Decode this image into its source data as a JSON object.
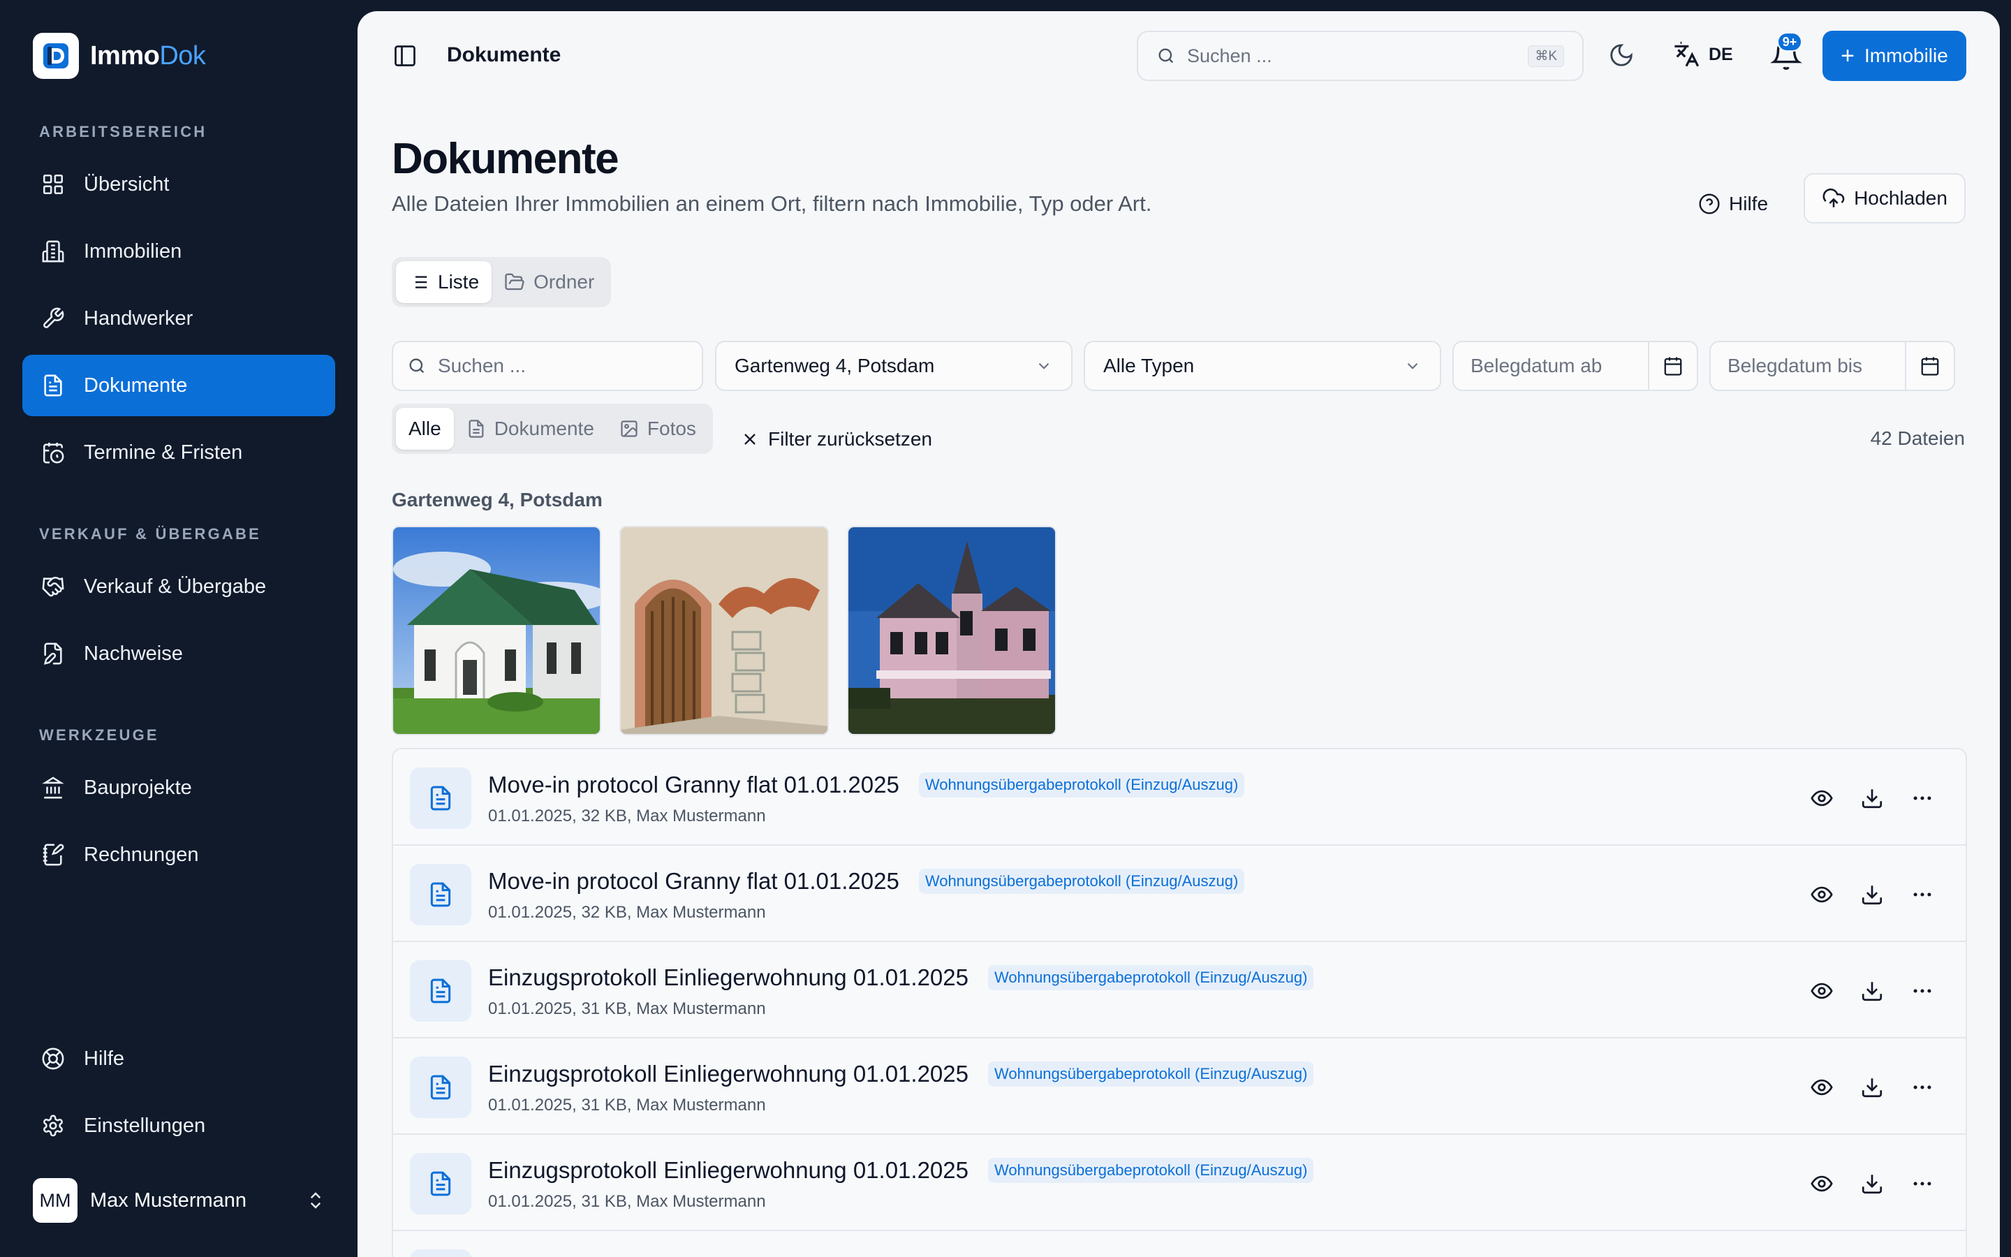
{
  "app": {
    "name_a": "Immo",
    "name_b": "Dok"
  },
  "sidebar": {
    "sections": [
      {
        "label": "ARBEITSBEREICH"
      },
      {
        "label": "VERKAUF & ÜBERGABE"
      },
      {
        "label": "WERKZEUGE"
      }
    ],
    "items": [
      {
        "label": "Übersicht",
        "icon": "dashboard-icon"
      },
      {
        "label": "Immobilien",
        "icon": "building-icon"
      },
      {
        "label": "Handwerker",
        "icon": "wrench-icon"
      },
      {
        "label": "Dokumente",
        "icon": "document-icon",
        "active": true
      },
      {
        "label": "Termine & Fristen",
        "icon": "calendar-clock-icon"
      },
      {
        "label": "Verkauf & Übergabe",
        "icon": "handshake-icon"
      },
      {
        "label": "Nachweise",
        "icon": "file-edit-icon"
      },
      {
        "label": "Bauprojekte",
        "icon": "bank-icon"
      },
      {
        "label": "Rechnungen",
        "icon": "receipt-icon"
      },
      {
        "label": "Hilfe",
        "icon": "lifebuoy-icon"
      },
      {
        "label": "Einstellungen",
        "icon": "gear-icon"
      }
    ],
    "user": {
      "initials": "MM",
      "name": "Max Mustermann"
    }
  },
  "topbar": {
    "breadcrumb": "Dokumente",
    "search_placeholder": "Suchen ...",
    "shortcut": "⌘K",
    "language": "DE",
    "notifications": "9+",
    "add_label": "Immobilie"
  },
  "page": {
    "title": "Dokumente",
    "subtitle": "Alle Dateien Ihrer Immobilien an einem Ort, filtern nach Immobilie, Typ oder Art.",
    "help_label": "Hilfe",
    "upload_label": "Hochladen",
    "view_tabs": [
      {
        "label": "Liste",
        "active": true
      },
      {
        "label": "Ordner"
      }
    ],
    "filters": {
      "search_placeholder": "Suchen ...",
      "property": "Gartenweg 4, Potsdam",
      "type": "Alle Typen",
      "date_from_placeholder": "Belegdatum ab",
      "date_to_placeholder": "Belegdatum bis"
    },
    "kind_tabs": [
      {
        "label": "Alle",
        "active": true
      },
      {
        "label": "Dokumente"
      },
      {
        "label": "Fotos"
      }
    ],
    "reset_label": "Filter zurücksetzen",
    "count": "42 Dateien",
    "group_title": "Gartenweg 4, Potsdam",
    "photos": [
      "white-church-photo",
      "arched-door-photo",
      "victorian-house-photo"
    ],
    "documents": [
      {
        "title": "Move-in protocol Granny flat 01.01.2025",
        "tag": "Wohnungsübergabeprotokoll (Einzug/Auszug)",
        "meta": "01.01.2025, 32 KB, Max Mustermann"
      },
      {
        "title": "Move-in protocol Granny flat 01.01.2025",
        "tag": "Wohnungsübergabeprotokoll (Einzug/Auszug)",
        "meta": "01.01.2025, 32 KB, Max Mustermann"
      },
      {
        "title": "Einzugsprotokoll Einliegerwohnung 01.01.2025",
        "tag": "Wohnungsübergabeprotokoll (Einzug/Auszug)",
        "meta": "01.01.2025, 31 KB, Max Mustermann"
      },
      {
        "title": "Einzugsprotokoll Einliegerwohnung 01.01.2025",
        "tag": "Wohnungsübergabeprotokoll (Einzug/Auszug)",
        "meta": "01.01.2025, 31 KB, Max Mustermann"
      },
      {
        "title": "Einzugsprotokoll Einliegerwohnung 01.01.2025",
        "tag": "Wohnungsübergabeprotokoll (Einzug/Auszug)",
        "meta": "01.01.2025, 31 KB, Max Mustermann"
      }
    ]
  },
  "colors": {
    "accent": "#0b6fd8",
    "sidebar_bg": "#101a2b",
    "main_bg": "#f6f7f9"
  }
}
